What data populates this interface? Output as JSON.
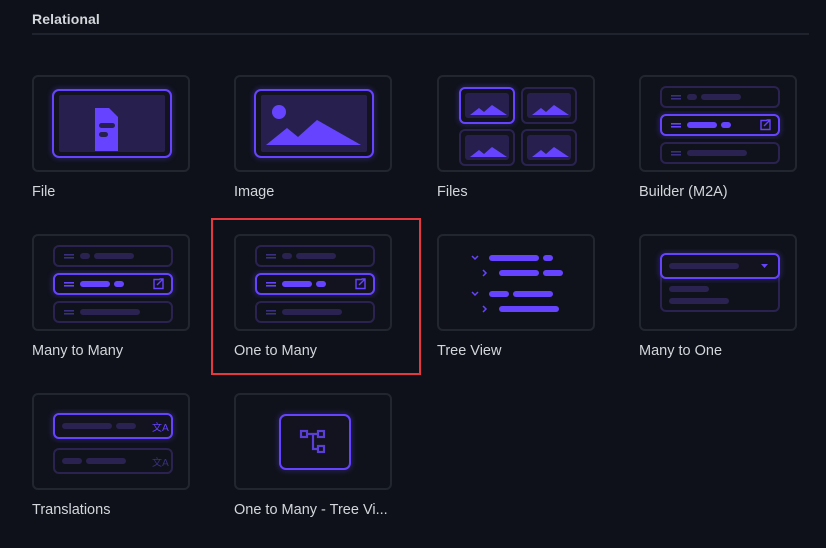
{
  "section": {
    "title": "Relational"
  },
  "interfaces": [
    {
      "label": "File",
      "icon": "file-icon",
      "selected": false
    },
    {
      "label": "Image",
      "icon": "image-icon",
      "selected": false
    },
    {
      "label": "Files",
      "icon": "files-grid-icon",
      "selected": false
    },
    {
      "label": "Builder (M2A)",
      "icon": "builder-list-icon",
      "selected": false
    },
    {
      "label": "Many to Many",
      "icon": "many-to-many-list-icon",
      "selected": false
    },
    {
      "label": "One to Many",
      "icon": "one-to-many-list-icon",
      "selected": true
    },
    {
      "label": "Tree View",
      "icon": "tree-view-icon",
      "selected": false
    },
    {
      "label": "Many to One",
      "icon": "dropdown-select-icon",
      "selected": false
    },
    {
      "label": "Translations",
      "icon": "translate-icon",
      "selected": false
    },
    {
      "label": "One to Many - Tree Vi...",
      "icon": "hierarchy-icon",
      "selected": false
    }
  ],
  "colors": {
    "accent": "#6644ff",
    "accent_dim": "#2a2250",
    "background": "#0e1119",
    "card_border": "#22262f",
    "selection": "#e5383f"
  }
}
